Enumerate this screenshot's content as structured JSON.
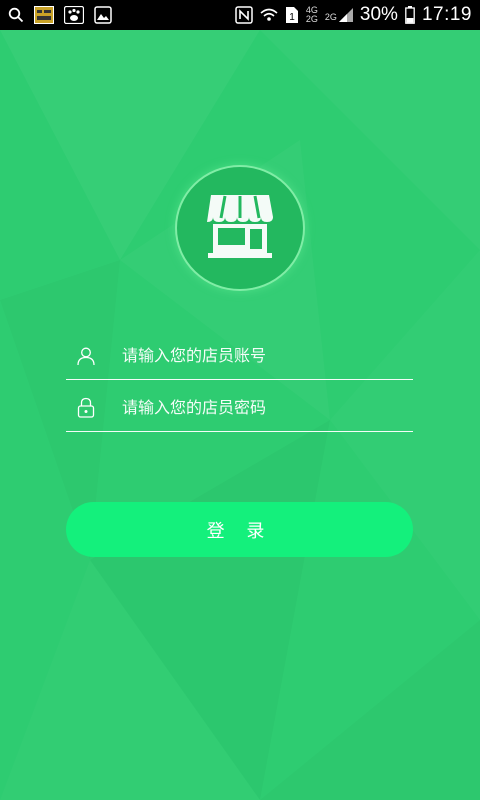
{
  "status_bar": {
    "left_icons": [
      "search-icon",
      "news-app-icon",
      "baidu-app-icon",
      "gallery-icon"
    ],
    "right_icons": [
      "nfc-icon",
      "wifi-icon",
      "sim1-icon",
      "signal-icon"
    ],
    "network_4g": "4G",
    "network_2g_a": "2G",
    "network_2g_b": "2G",
    "battery": "30%",
    "time": "17:19"
  },
  "logo": {
    "icon": "shop-icon"
  },
  "login": {
    "account_placeholder": "请输入您的店员账号",
    "password_placeholder": "请输入您的店员密码",
    "account_icon": "user-icon",
    "password_icon": "lock-icon",
    "button_label": "登 录"
  },
  "colors": {
    "background": "#2ecc71",
    "button": "#14f07c",
    "text": "#ffffff"
  }
}
